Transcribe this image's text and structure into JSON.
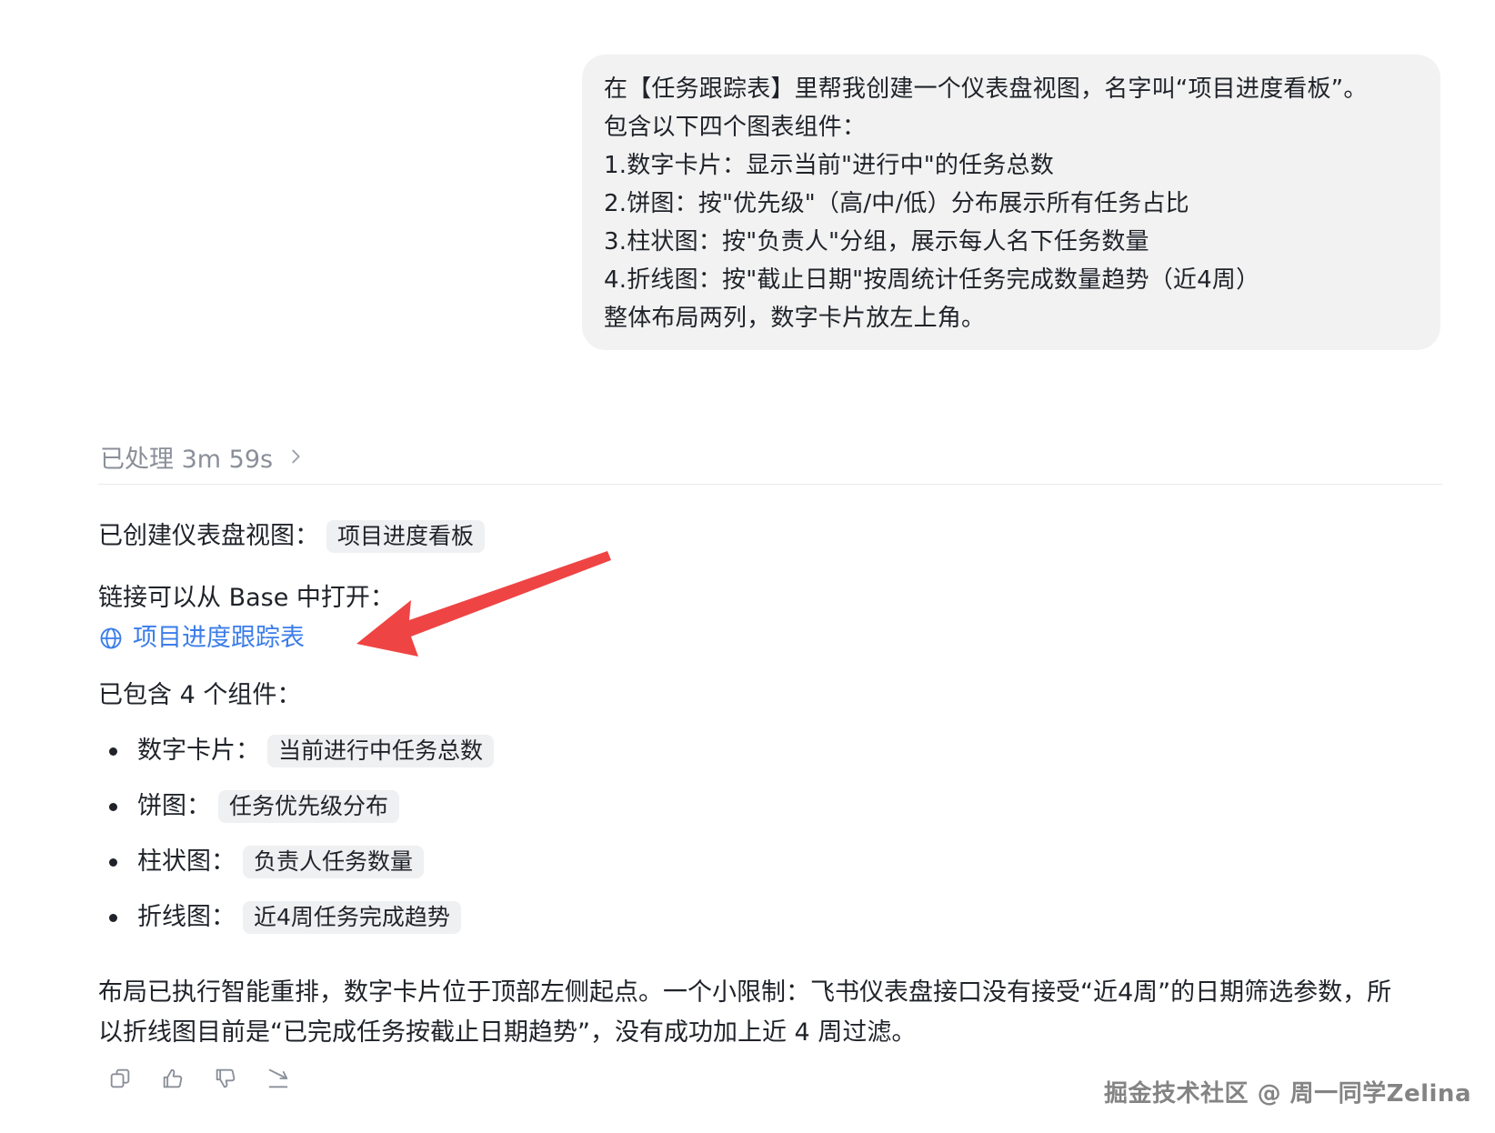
{
  "user_message": {
    "lines": [
      "在【任务跟踪表】里帮我创建一个仪表盘视图，名字叫“项目进度看板”。",
      "包含以下四个图表组件：",
      "1.数字卡片：显示当前\"进行中\"的任务总数",
      "2.饼图：按\"优先级\"（高/中/低）分布展示所有任务占比",
      "3.柱状图：按\"负责人\"分组，展示每人名下任务数量",
      "4.折线图：按\"截止日期\"按周统计任务完成数量趋势（近4周）",
      "整体布局两列，数字卡片放左上角。"
    ]
  },
  "processed": {
    "label": "已处理 3m 59s"
  },
  "response": {
    "created_label": "已创建仪表盘视图：",
    "created_chip": "项目进度看板",
    "link_intro": "链接可以从 Base 中打开：",
    "link_text": "项目进度跟踪表",
    "components_intro": "已包含 4 个组件：",
    "components": [
      {
        "label": "数字卡片：",
        "chip": "当前进行中任务总数"
      },
      {
        "label": "饼图：",
        "chip": "任务优先级分布"
      },
      {
        "label": "柱状图：",
        "chip": "负责人任务数量"
      },
      {
        "label": "折线图：",
        "chip": "近4周任务完成趋势"
      }
    ],
    "note_lines": [
      "布局已执行智能重排，数字卡片位于顶部左侧起点。一个小限制：飞书仪表盘接口没有接受“近4周”的日期筛选参数，所",
      "以折线图目前是“已完成任务按截止日期趋势”，没有成功加上近 4 周过滤。"
    ]
  },
  "actions": [
    "copy-icon",
    "thumbs-up-icon",
    "thumbs-down-icon",
    "share-icon"
  ],
  "watermark": "掘金技术社区 @ 周一同学Zelina",
  "colors": {
    "link": "#3b7de9",
    "arrow": "#ef4444",
    "bubble": "#f2f2f2"
  }
}
